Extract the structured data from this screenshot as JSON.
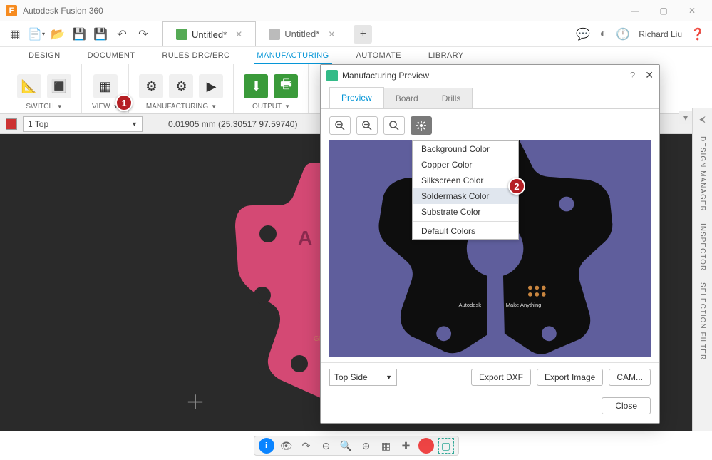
{
  "app": {
    "title": "Autodesk Fusion 360",
    "user": "Richard Liu"
  },
  "tabs": {
    "active": "Untitled*",
    "inactive": "Untitled*"
  },
  "ribbon_tabs": [
    "DESIGN",
    "DOCUMENT",
    "RULES DRC/ERC",
    "MANUFACTURING",
    "AUTOMATE",
    "LIBRARY"
  ],
  "ribbon_active": "MANUFACTURING",
  "ribbon_groups": {
    "switch": "SWITCH",
    "view": "VIEW",
    "manufacturing": "MANUFACTURING",
    "output": "OUTPUT"
  },
  "infobar": {
    "layer": "1 Top",
    "coords": "0.01905 mm (25.30517 97.59740)"
  },
  "right_panels": {
    "design_manager": "DESIGN MANAGER",
    "inspector": "INSPECTOR",
    "selection_filter": "SELECTION FILTER"
  },
  "dialog": {
    "title": "Manufacturing Preview",
    "tabs": {
      "preview": "Preview",
      "board": "Board",
      "drills": "Drills"
    },
    "menu": {
      "items": [
        "Background Color",
        "Copper Color",
        "Silkscreen Color",
        "Soldermask Color",
        "Substrate Color",
        "Default Colors"
      ],
      "highlighted": "Soldermask Color"
    },
    "side_select": "Top Side",
    "buttons": {
      "dxf": "Export DXF",
      "image": "Export Image",
      "cam": "CAM...",
      "close": "Close"
    }
  },
  "annotations": {
    "1": "1",
    "2": "2"
  }
}
